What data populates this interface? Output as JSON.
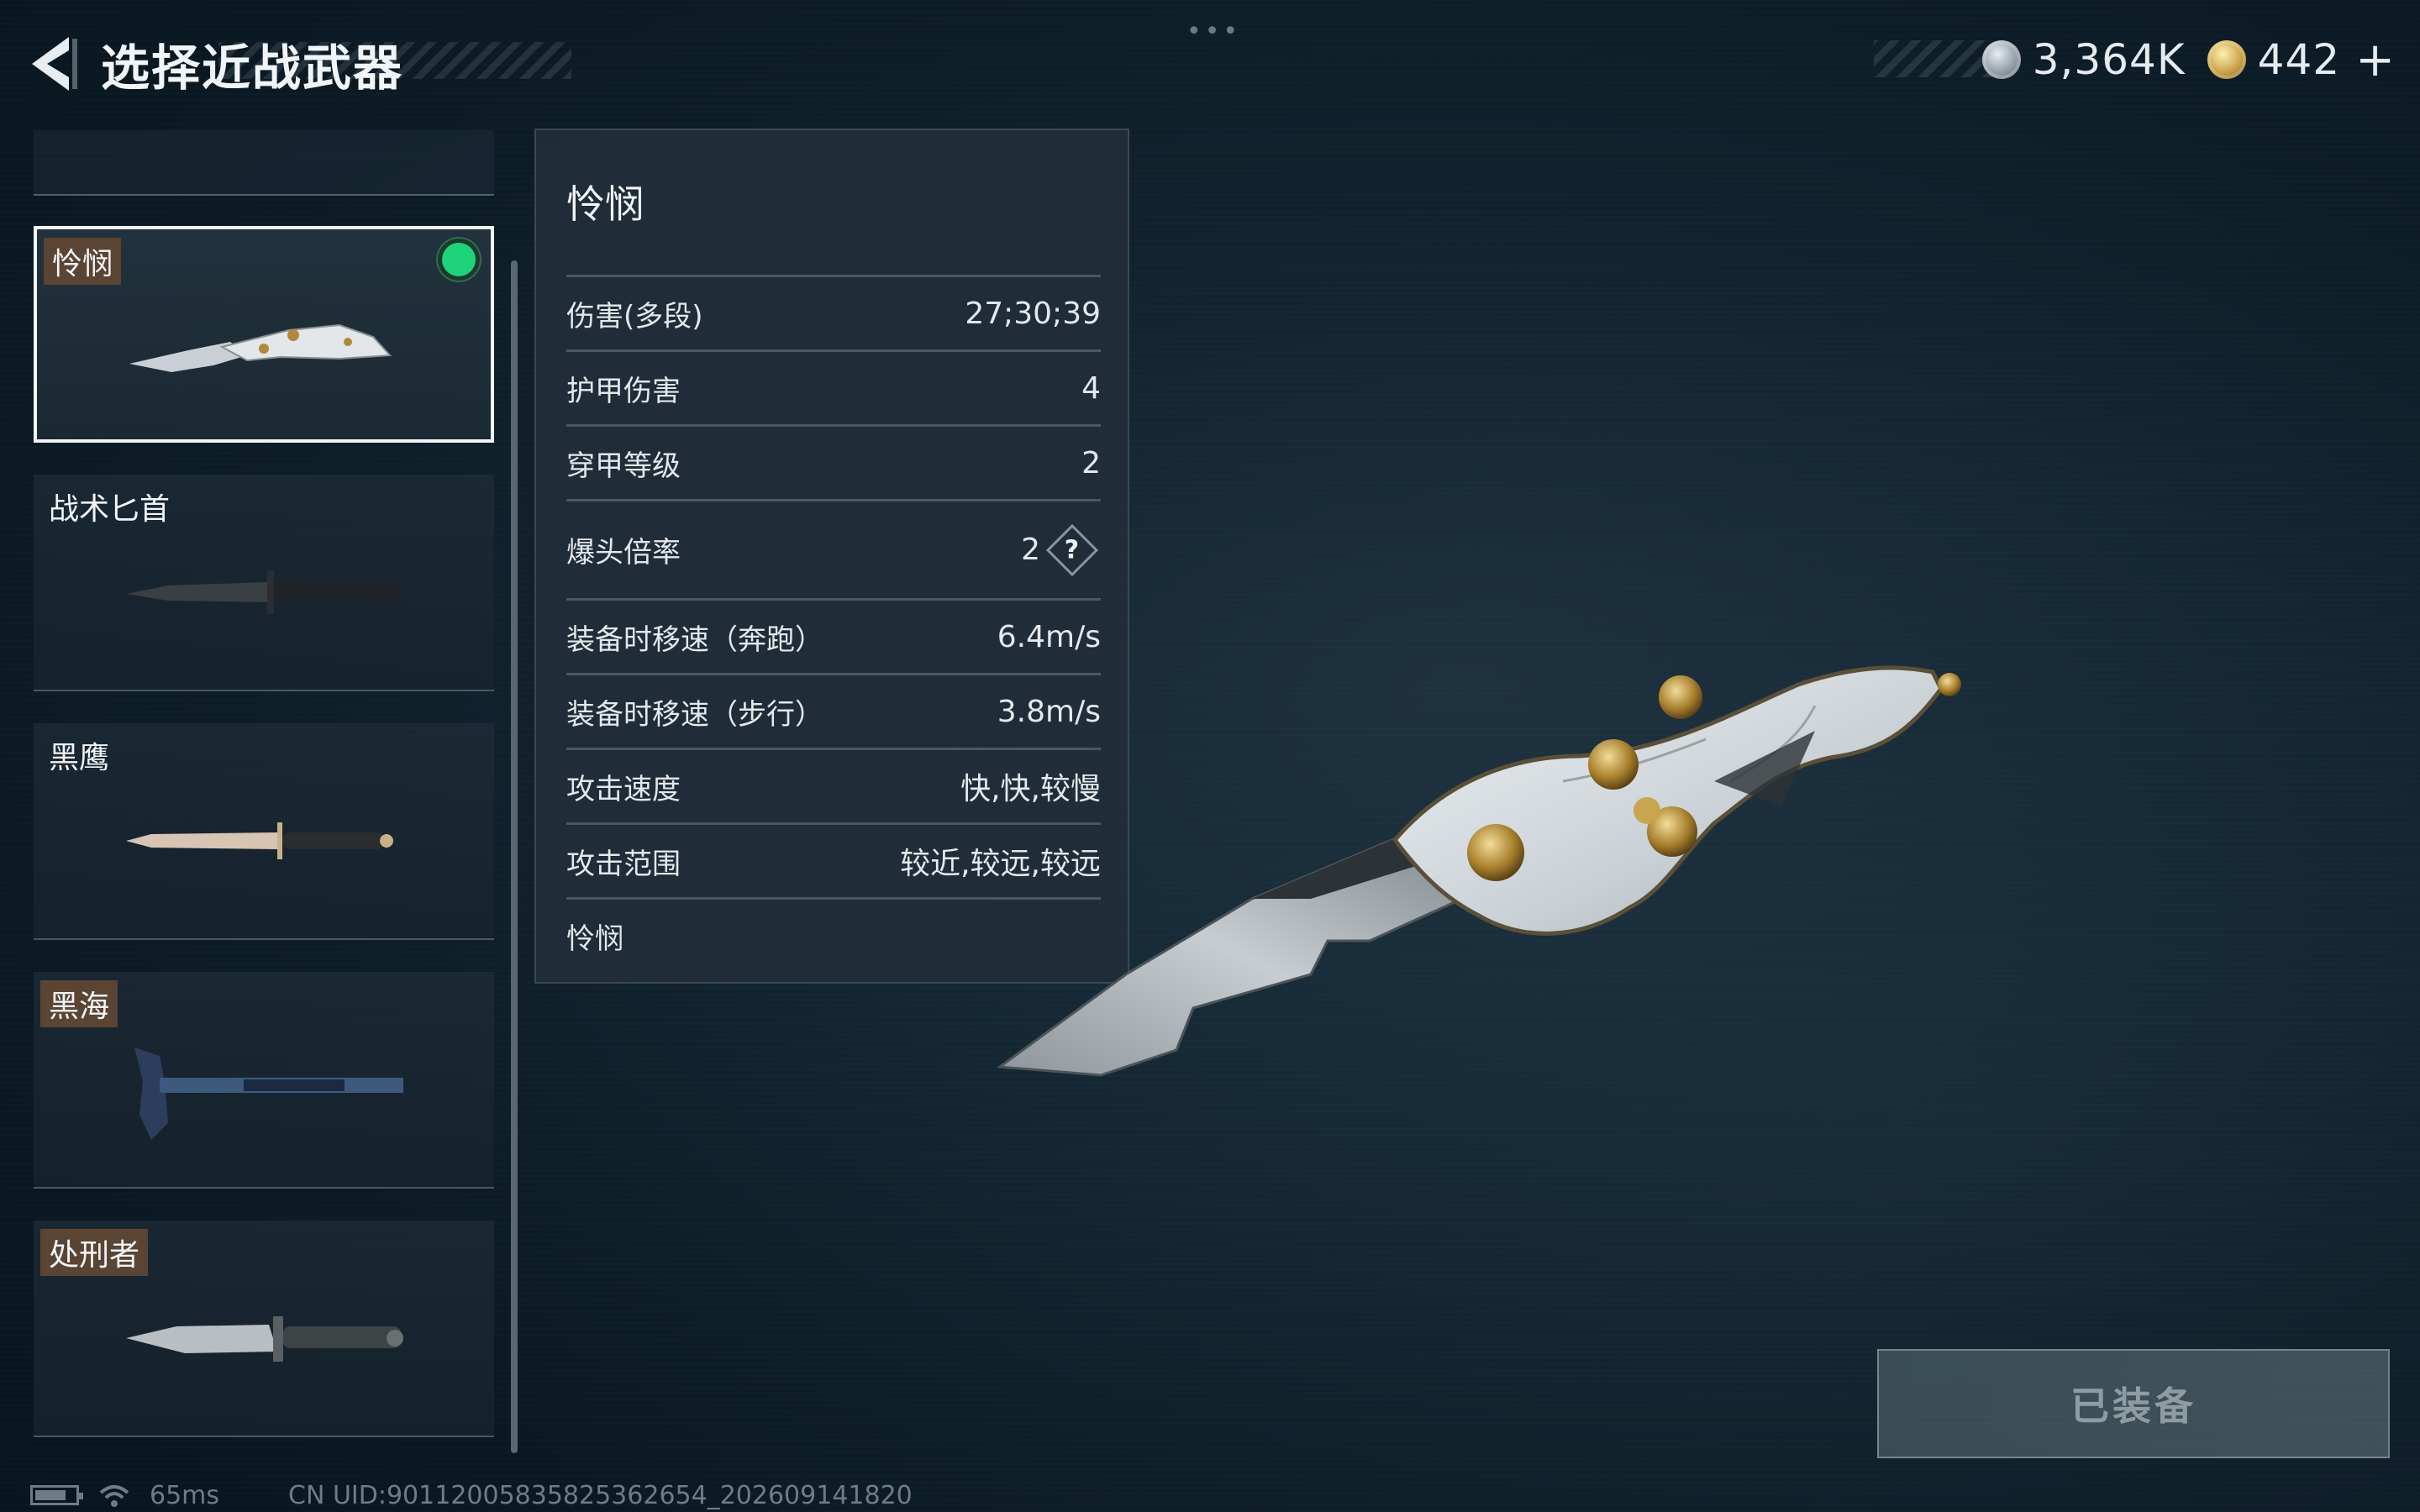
{
  "header": {
    "title": "选择近战武器",
    "silver_value": "3,364K",
    "gold_value": "442",
    "plus_label": "+"
  },
  "weapon_list": [
    {
      "name": "怜悯",
      "tag": true,
      "selected": true,
      "equipped": true
    },
    {
      "name": "战术匕首",
      "tag": false,
      "selected": false,
      "equipped": false
    },
    {
      "name": "黑鹰",
      "tag": false,
      "selected": false,
      "equipped": false
    },
    {
      "name": "黑海",
      "tag": true,
      "selected": false,
      "equipped": false
    },
    {
      "name": "处刑者",
      "tag": true,
      "selected": false,
      "equipped": false
    }
  ],
  "stats": {
    "title": "怜悯",
    "rows": [
      {
        "label": "伤害(多段)",
        "value": "27;30;39"
      },
      {
        "label": "护甲伤害",
        "value": "4"
      },
      {
        "label": "穿甲等级",
        "value": "2"
      },
      {
        "label": "爆头倍率",
        "value": "2",
        "help": "?"
      },
      {
        "label": "装备时移速（奔跑）",
        "value": "6.4m/s"
      },
      {
        "label": "装备时移速（步行）",
        "value": "3.8m/s"
      },
      {
        "label": "攻击速度",
        "value": "快,快,较慢"
      },
      {
        "label": "攻击范围",
        "value": "较近,较远,较远"
      }
    ],
    "description": "怜悯"
  },
  "equip_button": {
    "label": "已装备"
  },
  "footer": {
    "ping": "65ms",
    "uid": "CN UID:90112005835825362654_202609141820"
  },
  "icons": {
    "back": "chevron-left-icon",
    "silver": "silver-coin-icon",
    "gold": "gold-coin-icon",
    "equipped": "equipped-dot-icon",
    "help": "help-diamond-icon",
    "battery": "battery-icon",
    "wifi": "wifi-icon"
  },
  "colors": {
    "equipped_green": "#1fd37a",
    "tag_brown": "#5a4434",
    "panel_bg": "#222e38"
  }
}
